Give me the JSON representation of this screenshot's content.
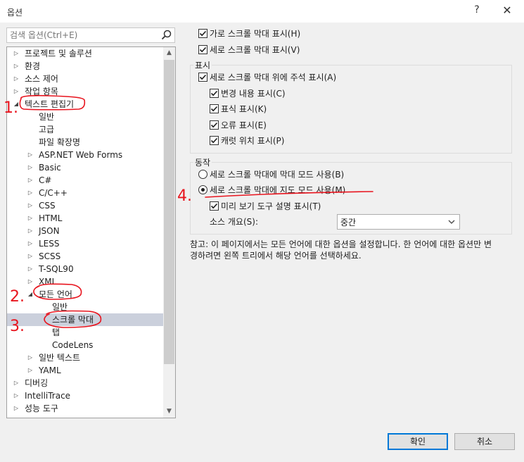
{
  "window": {
    "title": "옵션",
    "help": "?",
    "close": "✕"
  },
  "search": {
    "placeholder": "검색 옵션(Ctrl+E)"
  },
  "tree": [
    {
      "label": "프로젝트 및 솔루션",
      "caret": "▷"
    },
    {
      "label": "환경",
      "caret": "▷"
    },
    {
      "label": "소스 제어",
      "caret": "▷"
    },
    {
      "label": "작업 항목",
      "caret": "▷"
    },
    {
      "label": "텍스트 편집기",
      "caret": "◢"
    },
    {
      "label": "일반",
      "caret": ""
    },
    {
      "label": "고급",
      "caret": ""
    },
    {
      "label": "파일 확장명",
      "caret": ""
    },
    {
      "label": "ASP.NET Web Forms",
      "caret": "▷"
    },
    {
      "label": "Basic",
      "caret": "▷"
    },
    {
      "label": "C#",
      "caret": "▷"
    },
    {
      "label": "C/C++",
      "caret": "▷"
    },
    {
      "label": "CSS",
      "caret": "▷"
    },
    {
      "label": "HTML",
      "caret": "▷"
    },
    {
      "label": "JSON",
      "caret": "▷"
    },
    {
      "label": "LESS",
      "caret": "▷"
    },
    {
      "label": "SCSS",
      "caret": "▷"
    },
    {
      "label": "T-SQL90",
      "caret": "▷"
    },
    {
      "label": "XML",
      "caret": "▷"
    },
    {
      "label": "모든 언어",
      "caret": "◢"
    },
    {
      "label": "일반",
      "caret": ""
    },
    {
      "label": "스크롤 막대",
      "caret": ""
    },
    {
      "label": "탭",
      "caret": ""
    },
    {
      "label": "CodeLens",
      "caret": ""
    },
    {
      "label": "일반 텍스트",
      "caret": "▷"
    },
    {
      "label": "YAML",
      "caret": "▷"
    },
    {
      "label": "디버깅",
      "caret": "▷"
    },
    {
      "label": "IntelliTrace",
      "caret": "▷"
    },
    {
      "label": "성능 도구",
      "caret": "▷"
    }
  ],
  "options": {
    "horizontal_scrollbar": "가로 스크롤 막대 표시(H)",
    "vertical_scrollbar": "세로 스크롤 막대 표시(V)",
    "display_group": "표시",
    "show_annotations": "세로 스크롤 막대 위에 주석 표시(A)",
    "show_changes": "변경 내용 표시(C)",
    "show_marks": "표식 표시(K)",
    "show_errors": "오류 표시(E)",
    "show_caret": "캐럿 위치 표시(P)",
    "behavior_group": "동작",
    "bar_mode": "세로 스크롤 막대에 막대 모드 사용(B)",
    "map_mode": "세로 스크롤 막대에 지도 모드 사용(M)",
    "preview_tooltip": "미리 보기 도구 설명 표시(T)",
    "source_overview_label": "소스 개요(S):",
    "source_overview_value": "중간"
  },
  "note": "참고: 이 페이지에서는 모든 언어에 대한 옵션을 설정합니다. 한 언어에 대한 옵션만 변경하려면 왼쪽 트리에서 해당 언어를 선택하세요.",
  "buttons": {
    "ok": "확인",
    "cancel": "취소"
  },
  "annotations": {
    "a1": "1.",
    "a2": "2.",
    "a3": "3.",
    "a4": "4."
  },
  "colors": {
    "accent": "#0078d7",
    "selection": "#cbd0dc",
    "annotation": "#e8141e"
  }
}
